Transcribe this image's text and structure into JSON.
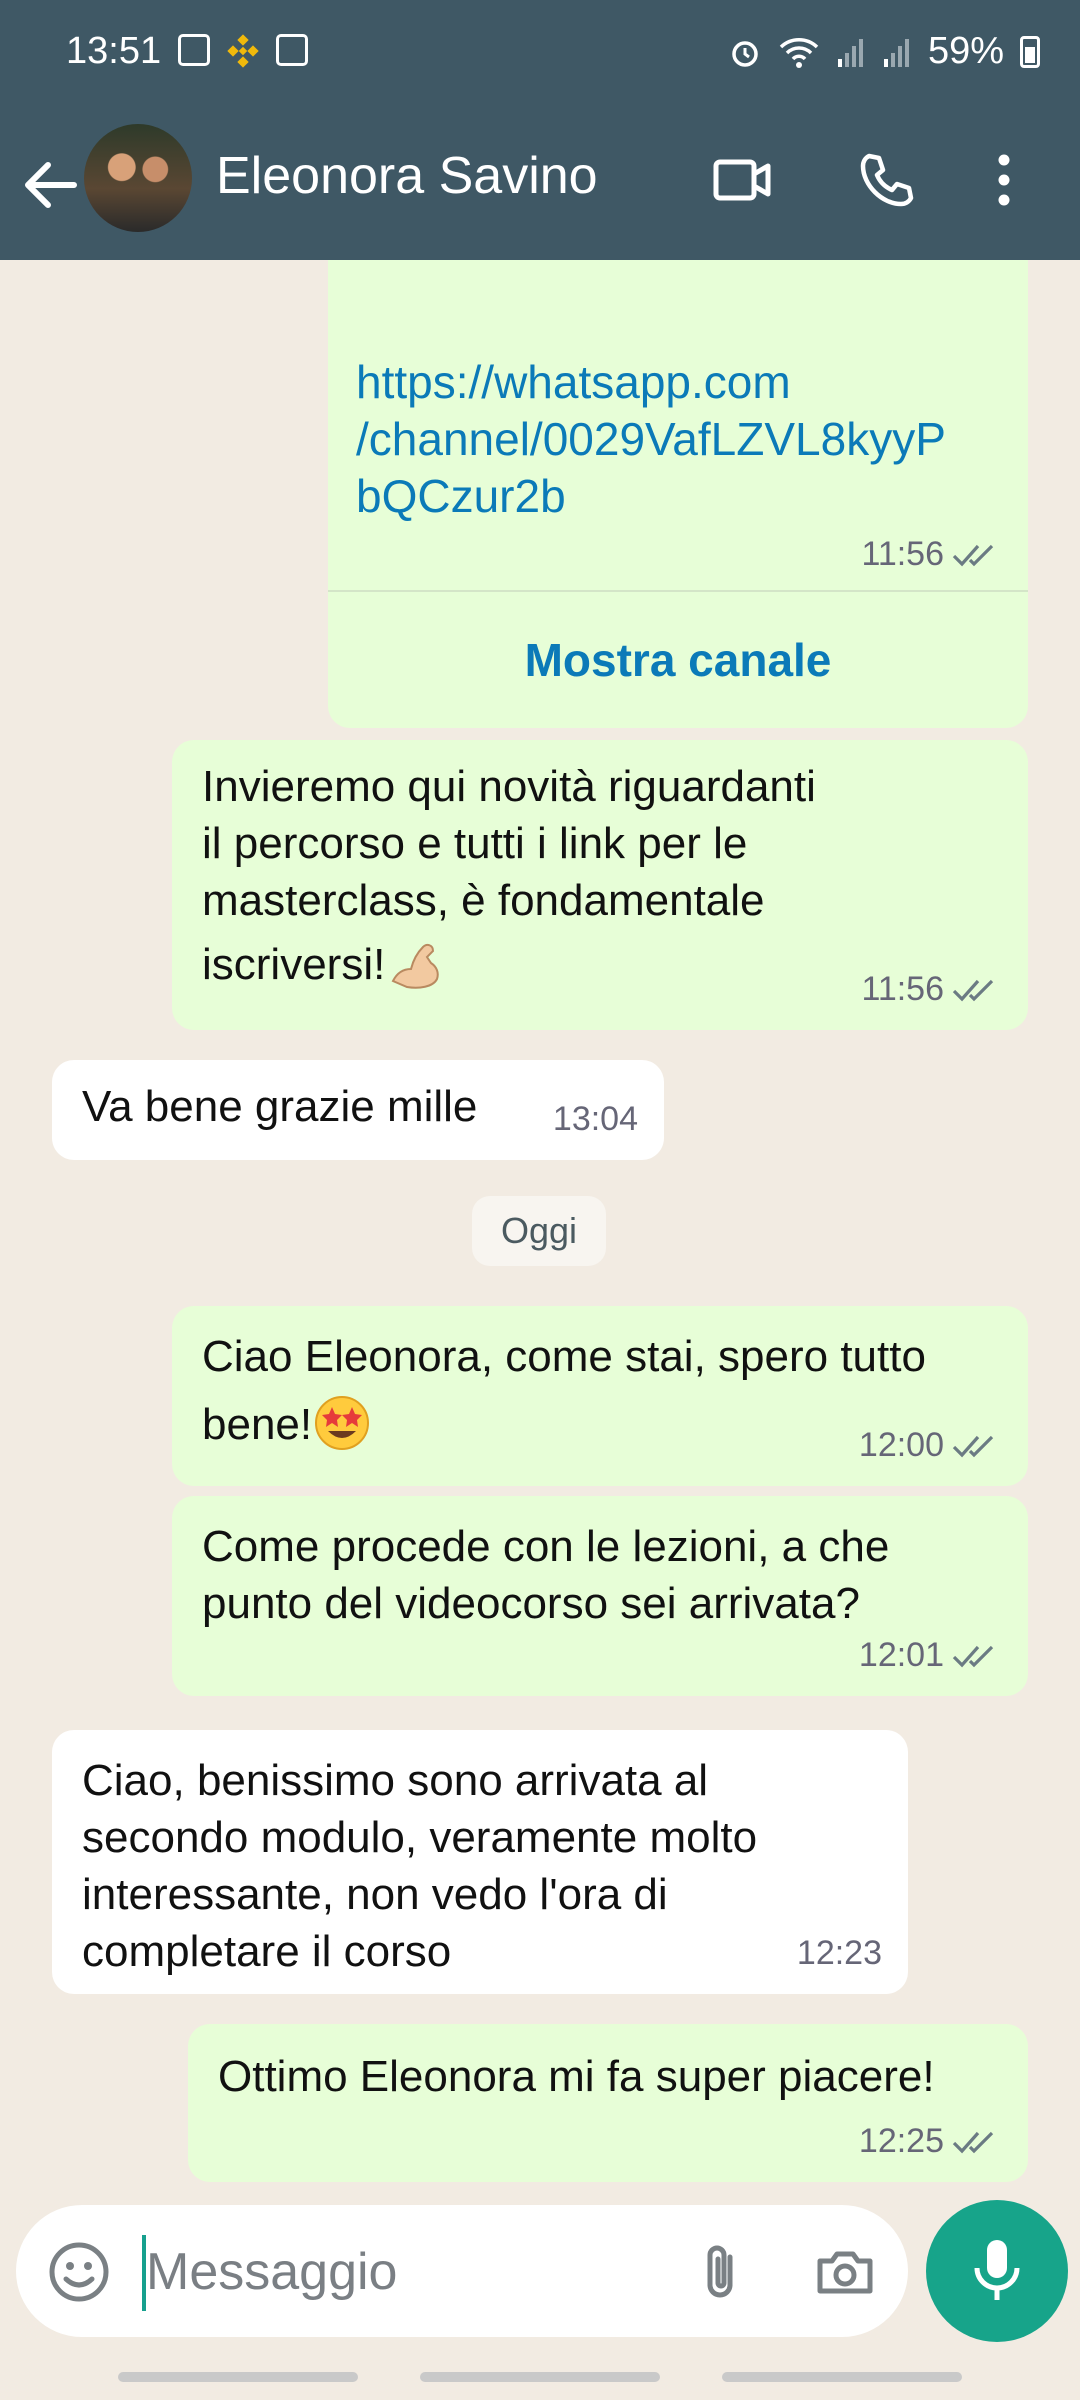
{
  "status_bar": {
    "time": "13:51",
    "battery": "59%"
  },
  "header": {
    "contact_name": "Eleonora Savino"
  },
  "messages": [
    {
      "from": "me",
      "link": "https://whatsapp.com/channel/0029VafLZVL8kyyPbQCzur2b",
      "link_lines": [
        "https://whatsapp.com",
        "/channel/0029VafLZVL8kyyP",
        "bQCzur2b"
      ],
      "time": "11:56",
      "button": "Mostra canale"
    },
    {
      "from": "me",
      "lines": [
        "Invieremo qui novità riguardanti",
        "il percorso e tutti i link per le",
        "masterclass, è fondamentale",
        "iscriversi!"
      ],
      "emoji": "flexed-biceps",
      "time": "11:56"
    },
    {
      "from": "them",
      "lines": [
        "Va bene grazie mille"
      ],
      "time": "13:04"
    },
    {
      "from": "me",
      "lines": [
        "Ciao Eleonora, come stai, spero tutto",
        "bene!"
      ],
      "emoji": "star-struck",
      "time": "12:00"
    },
    {
      "from": "me",
      "lines": [
        "Come procede con le lezioni, a che",
        "punto del videocorso sei arrivata?"
      ],
      "time": "12:01"
    },
    {
      "from": "them",
      "lines": [
        "Ciao, benissimo sono arrivata al",
        "secondo modulo, veramente molto",
        "interessante, non vedo l'ora di",
        "completare il corso"
      ],
      "time": "12:23"
    },
    {
      "from": "me",
      "lines": [
        "Ottimo Eleonora mi fa super piacere!"
      ],
      "time": "12:25"
    }
  ],
  "date_divider": "Oggi",
  "input": {
    "placeholder": "Messaggio"
  },
  "colors": {
    "header": "#3f5865",
    "outgoing": "#e7fed7",
    "incoming": "#ffffff",
    "accent": "#17a48a",
    "link": "#0b7ab8"
  },
  "icons": [
    "back-arrow-icon",
    "video-call-icon",
    "phone-icon",
    "more-vert-icon",
    "emoji-icon",
    "attach-icon",
    "camera-icon",
    "mic-icon"
  ]
}
